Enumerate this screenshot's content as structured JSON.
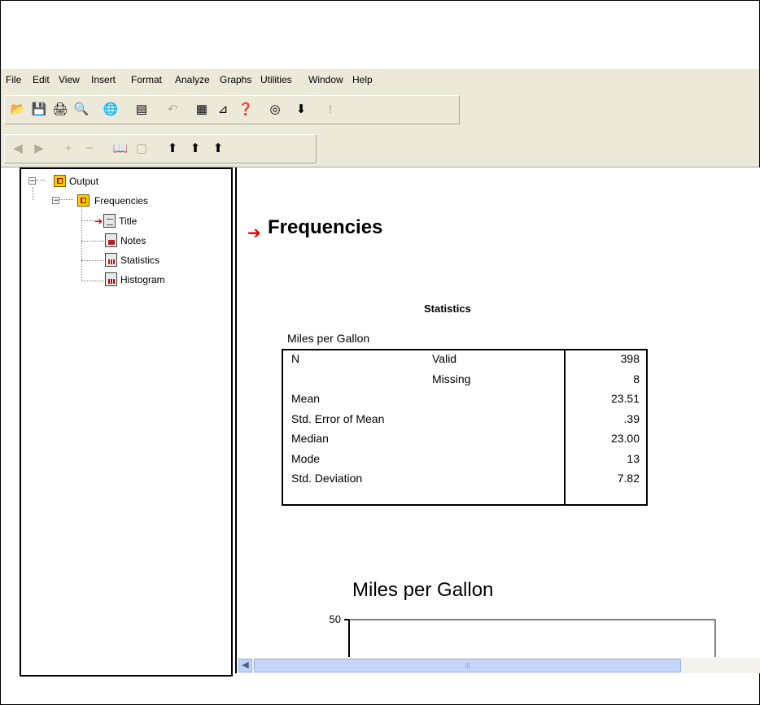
{
  "menu": [
    "File",
    "Edit",
    "View",
    "Insert",
    "Format",
    "Analyze",
    "Graphs",
    "Utilities",
    "Window",
    "Help"
  ],
  "toolbar1": [
    {
      "icon": "open-folder-icon",
      "glyph": "📂"
    },
    {
      "icon": "save-icon",
      "glyph": "💾"
    },
    {
      "icon": "print-icon",
      "glyph": "🖨"
    },
    {
      "icon": "print-preview-icon",
      "glyph": "🔍"
    },
    {
      "icon": "export-icon",
      "glyph": "🌐"
    },
    {
      "icon": "recall-dialog-icon",
      "glyph": "▤"
    },
    {
      "icon": "undo-icon",
      "glyph": "↶",
      "disabled": true
    },
    {
      "icon": "goto-data-icon",
      "glyph": "▦"
    },
    {
      "icon": "goto-case-icon",
      "glyph": "⊿"
    },
    {
      "icon": "variables-icon",
      "glyph": "❓"
    },
    {
      "icon": "use-sets-icon",
      "glyph": "◎"
    },
    {
      "icon": "designate-window-icon",
      "glyph": "⬇"
    },
    {
      "icon": "run-icon",
      "glyph": "!",
      "disabled": true
    }
  ],
  "toolbar2": [
    {
      "icon": "promote-icon",
      "glyph": "◀",
      "disabled": true
    },
    {
      "icon": "demote-icon",
      "glyph": "▶",
      "disabled": true
    },
    {
      "icon": "expand-icon",
      "glyph": "+",
      "disabled": true
    },
    {
      "icon": "collapse-icon",
      "glyph": "−",
      "disabled": true
    },
    {
      "icon": "show-icon",
      "glyph": "📖",
      "disabled": true
    },
    {
      "icon": "hide-icon",
      "glyph": "▢",
      "disabled": true
    },
    {
      "icon": "insert-heading-icon",
      "glyph": "⬆"
    },
    {
      "icon": "insert-title-icon",
      "glyph": "⬆"
    },
    {
      "icon": "insert-text-icon",
      "glyph": "⬆"
    }
  ],
  "tree": {
    "root": "Output",
    "child": "Frequencies",
    "items": [
      "Title",
      "Notes",
      "Statistics",
      "Histogram"
    ]
  },
  "content": {
    "heading": "Frequencies",
    "stats_caption": "Statistics",
    "stats_variable": "Miles per Gallon",
    "rows": [
      {
        "label": "N",
        "sub": "Valid",
        "value": "398"
      },
      {
        "label": "",
        "sub": "Missing",
        "value": "8"
      },
      {
        "label": "Mean",
        "sub": "",
        "value": "23.51"
      },
      {
        "label": "Std. Error of Mean",
        "sub": "",
        "value": ".39"
      },
      {
        "label": "Median",
        "sub": "",
        "value": "23.00"
      },
      {
        "label": "Mode",
        "sub": "",
        "value": "13"
      },
      {
        "label": "Std. Deviation",
        "sub": "",
        "value": "7.82"
      }
    ],
    "chart_title": "Miles per Gallon",
    "chart_y_tick": "50"
  },
  "colors": {
    "chrome": "#ece9d8",
    "arrow": "#e00000",
    "folder": "#f4d000"
  }
}
